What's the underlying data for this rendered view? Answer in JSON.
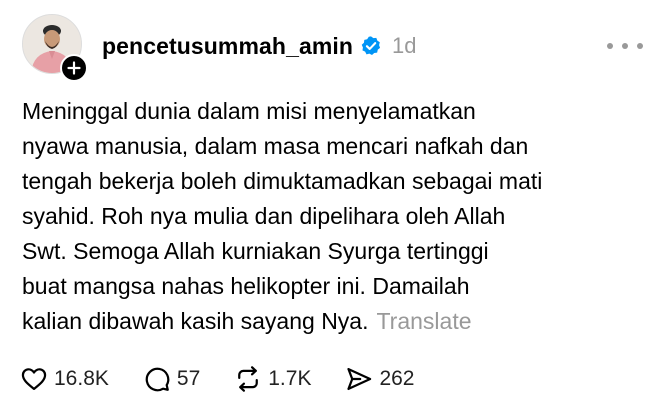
{
  "post": {
    "username": "pencetusummah_amin",
    "time": "1d",
    "body_lines": [
      "Meninggal dunia dalam misi menyelamatkan",
      "nyawa manusia, dalam masa mencari nafkah dan",
      "tengah bekerja boleh dimuktamadkan sebagai mati",
      "syahid. Roh nya mulia dan dipelihara oleh Allah",
      "Swt. Semoga Allah kurniakan Syurga tertinggi",
      "buat mangsa nahas helikopter ini. Damailah",
      "kalian dibawah kasih sayang Nya."
    ],
    "translate_label": "Translate"
  },
  "actions": {
    "likes": "16.8K",
    "comments": "57",
    "reposts": "1.7K",
    "shares": "262"
  },
  "icons": {
    "verified": "verified-badge-icon",
    "follow": "plus-icon",
    "more": "more-horizontal-icon",
    "like": "heart-icon",
    "comment": "comment-bubble-icon",
    "repost": "repost-icon",
    "share": "send-icon"
  },
  "colors": {
    "verified_blue": "#0095f6",
    "muted_gray": "#999999",
    "text": "#000000"
  }
}
